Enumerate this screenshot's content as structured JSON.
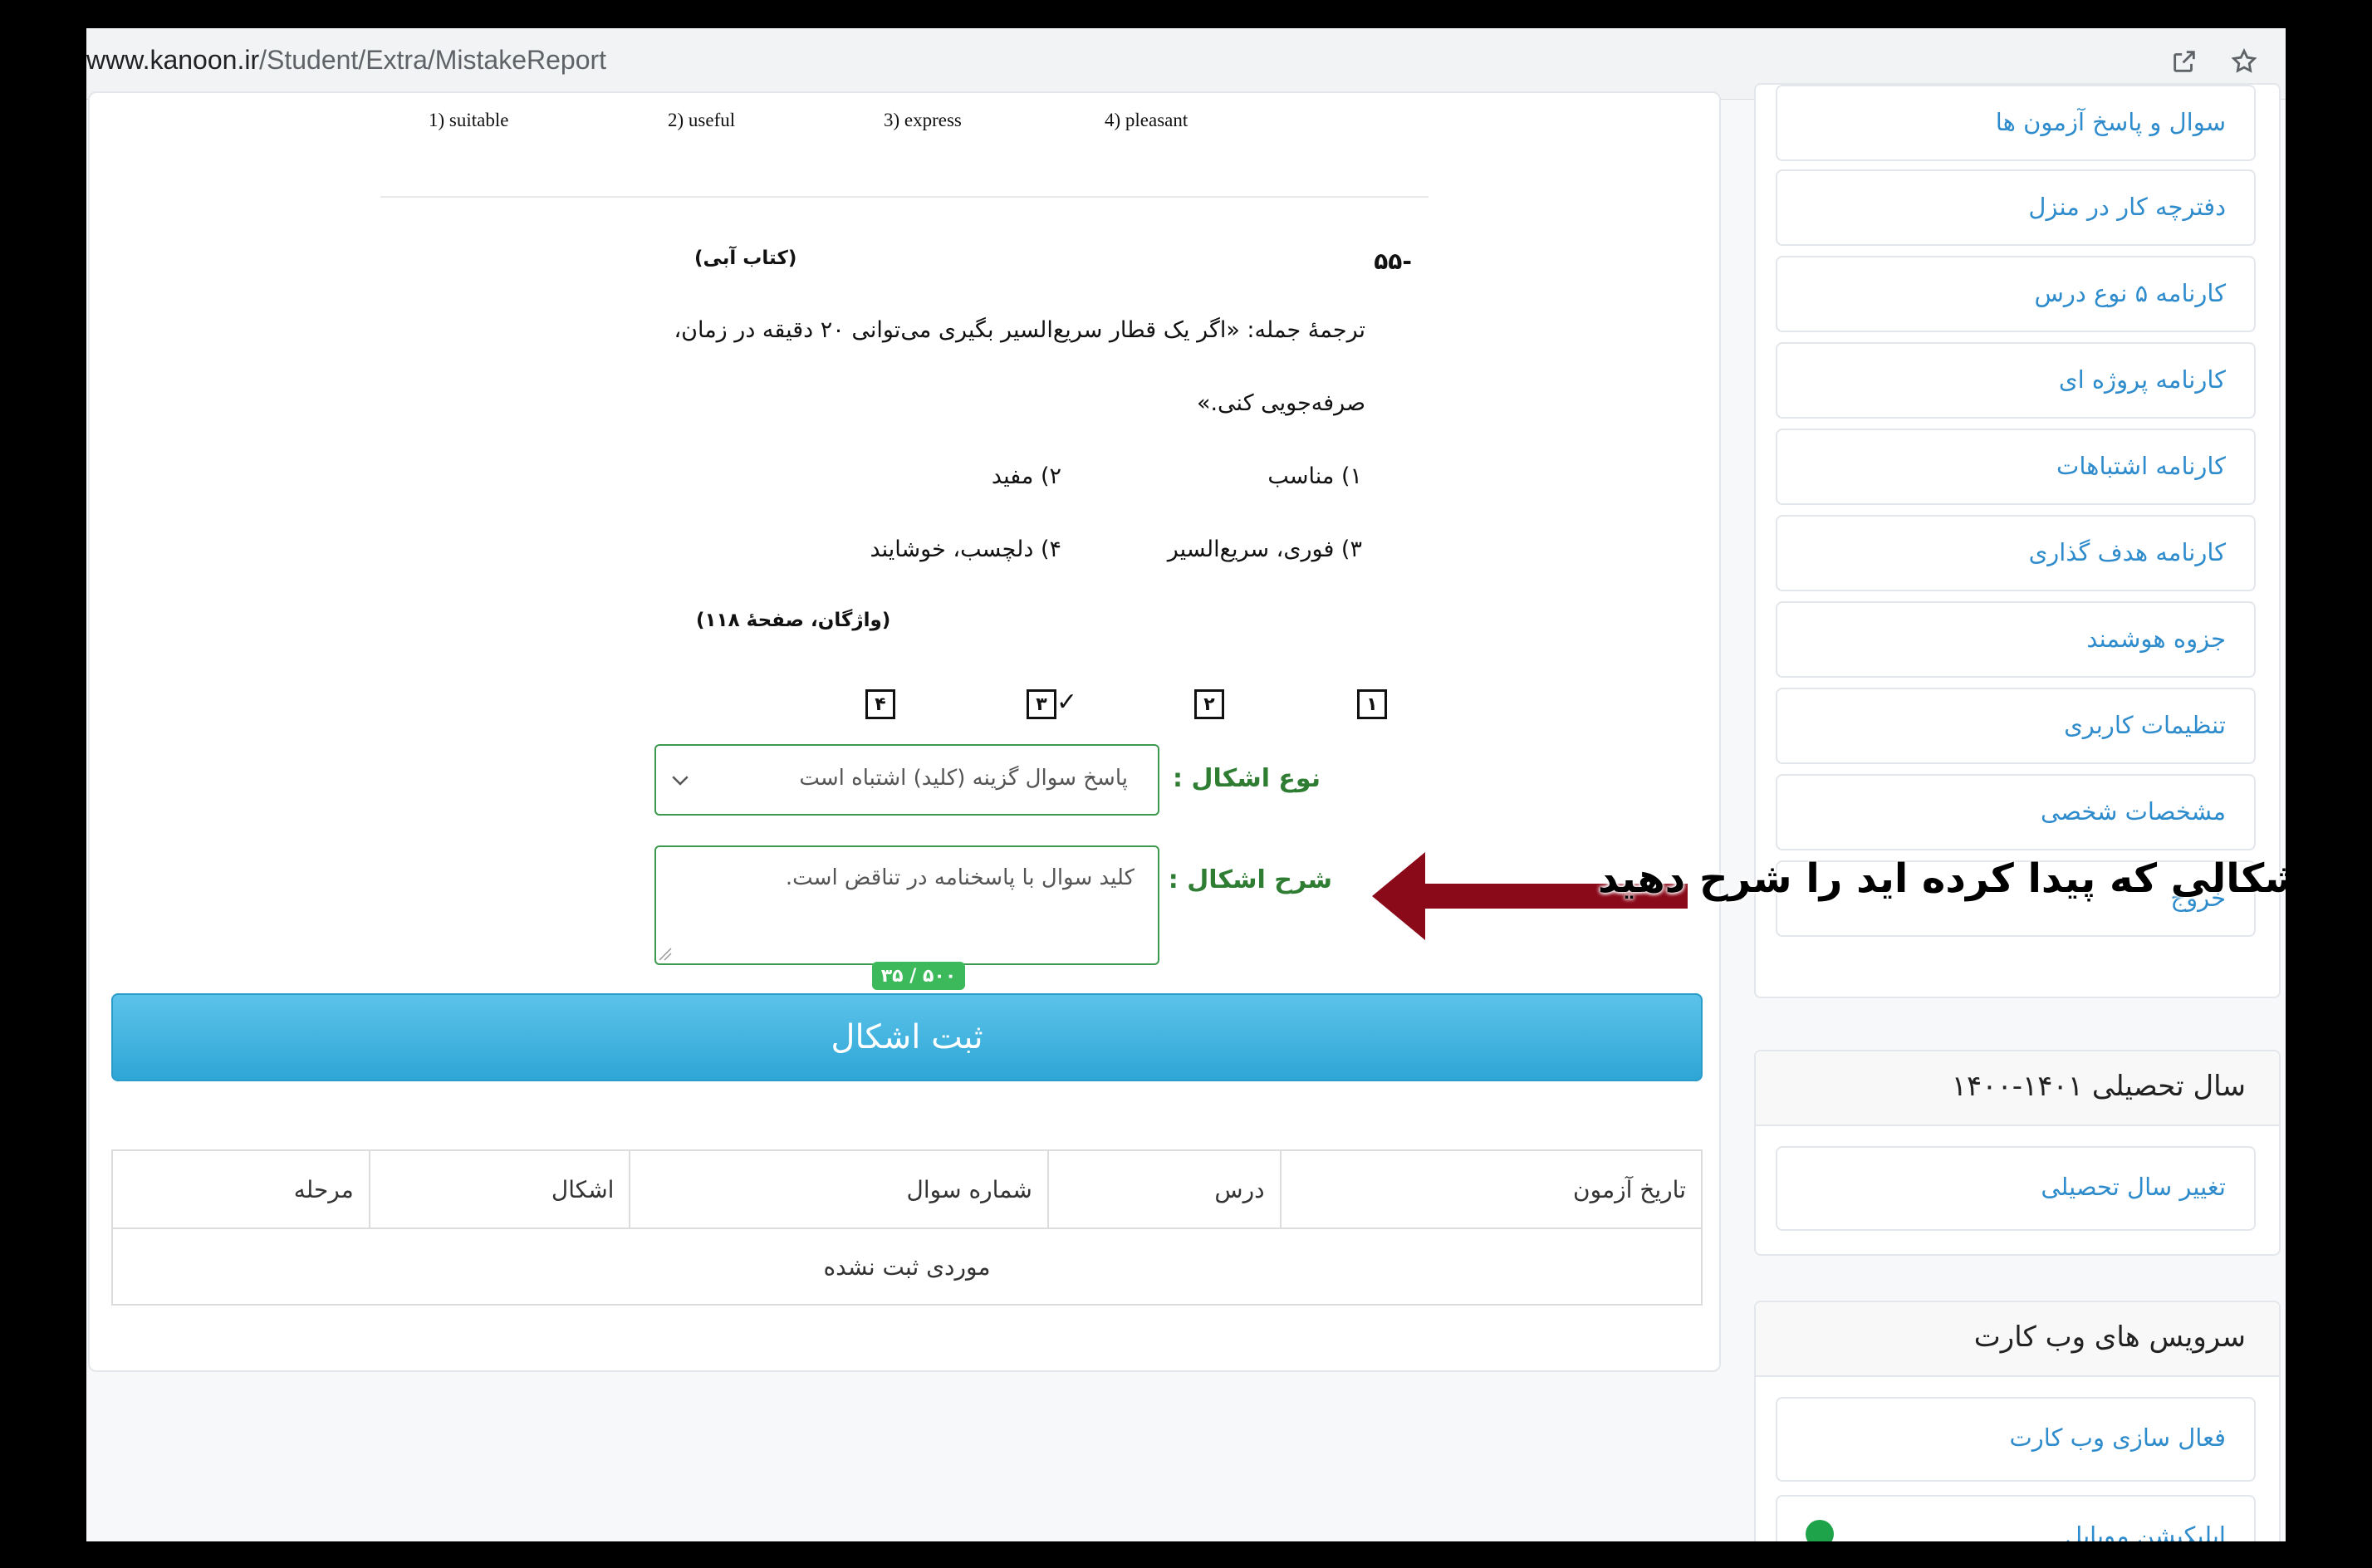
{
  "browser": {
    "url_prefix": "www.kanoon.ir",
    "url_path": "/Student/Extra/MistakeReport"
  },
  "question": {
    "prev_options": [
      "1) suitable",
      "2) useful",
      "3) express",
      "4) pleasant"
    ],
    "number": "-۵۵",
    "source": "(کتاب آبی)",
    "text_line1": "ترجمهٔ جمله: «اگر یک قطار سریع‌السیر بگیری می‌توانی ۲۰ دقیقه در زمان،",
    "text_line2": "صرفه‌جویی کنی.»",
    "choice1": "۱) مناسب",
    "choice2": "۲) مفید",
    "choice3": "۳) فوری، سریع‌السیر",
    "choice4": "۴) دلچسب، خوشایند",
    "reference": "(واژگان، صفحهٔ ۱۱۸)",
    "answer_boxes": [
      "۱",
      "۲",
      "۳",
      "۴"
    ],
    "checked_answer": "۳"
  },
  "form": {
    "type_label": "نوع اشکال :",
    "type_value": "پاسخ سوال گزینه (کلید) اشتباه است",
    "desc_label": "شرح اشکال :",
    "desc_value": "کلید سوال با پاسخنامه در تناقض است.",
    "counter": "۵۰۰ / ۳۵",
    "submit_label": "ثبت اشکال"
  },
  "table": {
    "headers": [
      "تاریخ آزمون",
      "درس",
      "شماره سوال",
      "اشکال",
      "مرحله"
    ],
    "empty_message": "موردی ثبت نشده"
  },
  "sidebar": {
    "menu_items": [
      "سوال و پاسخ آزمون ها",
      "دفترچه کار در منزل",
      "کارنامه ۵ نوع درس",
      "کارنامه پروژه ای",
      "کارنامه اشتباهات",
      "کارنامه هدف گذاری",
      "جزوه هوشمند",
      "تنظیمات کاربری",
      "مشخصات شخصی",
      "خروج"
    ],
    "year_header": "سال تحصیلی ۱۴۰۱-۱۴۰۰",
    "year_change": "تغییر سال تحصیلی",
    "services_header": "سرویس های وب کارت",
    "services_items": [
      "فعال سازی وب کارت",
      "اپلیکیشن موبایل"
    ]
  },
  "annotation": {
    "text": "اشکالی که پیدا کرده اید را شرح دهید",
    "arrow_color": "#8b0a1a"
  }
}
